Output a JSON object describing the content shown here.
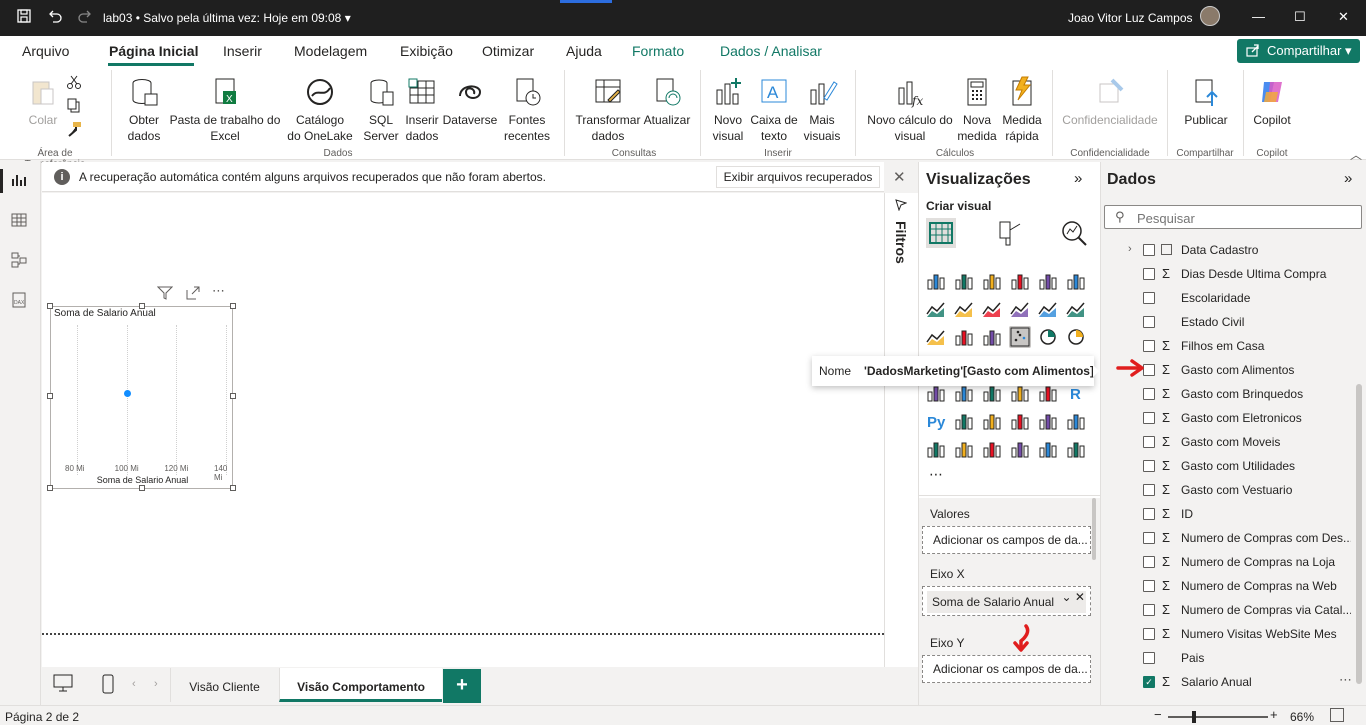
{
  "titlebar": {
    "file_name": "lab03",
    "save_status": "• Salvo pela última vez: Hoje em 09:08",
    "user_name": "Joao Vitor Luz Campos"
  },
  "menu": {
    "tabs": [
      "Arquivo",
      "Página Inicial",
      "Inserir",
      "Modelagem",
      "Exibição",
      "Otimizar",
      "Ajuda",
      "Formato",
      "Dados / Analisar"
    ],
    "active_tab": "Página Inicial",
    "share_label": "Compartilhar"
  },
  "ribbon": {
    "clipboard": {
      "paste": "Colar",
      "group": "Área de Transferência"
    },
    "data": {
      "get_data": "Obter\ndados",
      "excel": "Pasta de trabalho do\nExcel",
      "onelake": "Catálogo\ndo OneLake",
      "sql": "SQL\nServer",
      "enter_data": "Inserir\ndados",
      "dataverse": "Dataverse",
      "recent": "Fontes\nrecentes",
      "group": "Dados"
    },
    "queries": {
      "transform": "Transformar\ndados",
      "refresh": "Atualizar",
      "group": "Consultas"
    },
    "insert": {
      "new_visual": "Novo\nvisual",
      "text_box": "Caixa de\ntexto",
      "more_visuals": "Mais\nvisuais",
      "group": "Inserir"
    },
    "calculations": {
      "new_calc": "Novo cálculo do\nvisual",
      "new_measure": "Nova\nmedida",
      "quick_measure": "Medida\nrápida",
      "group": "Cálculos"
    },
    "sensitivity": {
      "label": "Confidencialidade",
      "group": "Confidencialidade"
    },
    "share": {
      "publish": "Publicar",
      "group": "Compartilhar"
    },
    "copilot": {
      "label": "Copilot",
      "group": "Copilot"
    }
  },
  "infobar": {
    "message": "A recuperação automática contém alguns arquivos recuperados que não foram abertos.",
    "button": "Exibir arquivos recuperados"
  },
  "visual": {
    "title": "Soma de Salario Anual",
    "x_ticks": [
      "80 Mi",
      "100 Mi",
      "120 Mi",
      "140 Mi"
    ],
    "x_label": "Soma de Salario Anual"
  },
  "chart_data": {
    "type": "scatter",
    "title": "Soma de Salario Anual",
    "xlabel": "Soma de Salario Anual",
    "x_ticks": [
      "80 Mi",
      "100 Mi",
      "120 Mi",
      "140 Mi"
    ],
    "points": [
      {
        "x": 100.5
      }
    ]
  },
  "filters_pane": {
    "label": "Filtros"
  },
  "visualizations": {
    "title": "Visualizações",
    "build_visual": "Criar visual",
    "wells": {
      "values_label": "Valores",
      "values_placeholder": "Adicionar os campos de da...",
      "x_axis_label": "Eixo X",
      "x_axis_field": "Soma de Salario Anual",
      "y_axis_label": "Eixo Y",
      "y_axis_placeholder": "Adicionar os campos de da..."
    }
  },
  "data_pane": {
    "title": "Dados",
    "search_placeholder": "Pesquisar",
    "fields": [
      {
        "label": "Data Cadastro",
        "type": "date",
        "checked": false
      },
      {
        "label": "Dias Desde Ultima Compra",
        "type": "sum",
        "checked": false
      },
      {
        "label": "Escolaridade",
        "type": "text",
        "checked": false
      },
      {
        "label": "Estado Civil",
        "type": "text",
        "checked": false
      },
      {
        "label": "Filhos em Casa",
        "type": "sum",
        "checked": false
      },
      {
        "label": "Gasto com Alimentos",
        "type": "sum",
        "checked": false
      },
      {
        "label": "Gasto com Brinquedos",
        "type": "sum",
        "checked": false
      },
      {
        "label": "Gasto com Eletronicos",
        "type": "sum",
        "checked": false
      },
      {
        "label": "Gasto com Moveis",
        "type": "sum",
        "checked": false
      },
      {
        "label": "Gasto com Utilidades",
        "type": "sum",
        "checked": false
      },
      {
        "label": "Gasto com Vestuario",
        "type": "sum",
        "checked": false
      },
      {
        "label": "ID",
        "type": "sum",
        "checked": false
      },
      {
        "label": "Numero de Compras com Des...",
        "type": "sum",
        "checked": false
      },
      {
        "label": "Numero de Compras na Loja",
        "type": "sum",
        "checked": false
      },
      {
        "label": "Numero de Compras na Web",
        "type": "sum",
        "checked": false
      },
      {
        "label": "Numero de Compras via Catal...",
        "type": "sum",
        "checked": false
      },
      {
        "label": "Numero Visitas WebSite Mes",
        "type": "sum",
        "checked": false
      },
      {
        "label": "Pais",
        "type": "text",
        "checked": false
      },
      {
        "label": "Salario Anual",
        "type": "sum",
        "checked": true
      }
    ]
  },
  "tooltip": {
    "key": "Nome",
    "value": "'DadosMarketing'[Gasto com Alimentos]"
  },
  "pages": {
    "tabs": [
      "Visão Cliente",
      "Visão Comportamento"
    ],
    "active": "Visão Comportamento"
  },
  "status": {
    "page_indicator": "Página 2 de 2",
    "zoom": "66%"
  },
  "colors": {
    "accent": "#117865",
    "dark_titlebar": "#1f1f1f",
    "point": "#118dff",
    "annotation_arrow": "#e01e1e"
  }
}
